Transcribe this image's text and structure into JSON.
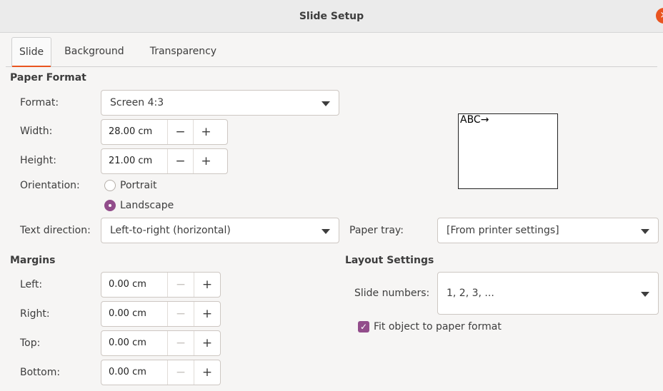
{
  "window": {
    "title": "Slide Setup",
    "close_glyph": "×"
  },
  "tabs": [
    {
      "label": "Slide",
      "active": true
    },
    {
      "label": "Background",
      "active": false
    },
    {
      "label": "Transparency",
      "active": false
    }
  ],
  "paper_format": {
    "heading": "Paper Format",
    "format_label": "Format:",
    "format_value": "Screen 4:3",
    "width_label": "Width:",
    "width_value": "28.00 cm",
    "height_label": "Height:",
    "height_value": "21.00 cm",
    "orientation_label": "Orientation:",
    "portrait_label": "Portrait",
    "landscape_label": "Landscape",
    "orientation_selected": "Landscape",
    "text_direction_label": "Text direction:",
    "text_direction_value": "Left-to-right (horizontal)",
    "paper_tray_label": "Paper tray:",
    "paper_tray_value": "[From printer settings]",
    "preview_text": "ABC→"
  },
  "margins": {
    "heading": "Margins",
    "left_label": "Left:",
    "left_value": "0.00 cm",
    "right_label": "Right:",
    "right_value": "0.00 cm",
    "top_label": "Top:",
    "top_value": "0.00 cm",
    "bottom_label": "Bottom:",
    "bottom_value": "0.00 cm"
  },
  "layout_settings": {
    "heading": "Layout Settings",
    "slide_numbers_label": "Slide numbers:",
    "slide_numbers_value": "1, 2, 3, ...",
    "fit_object_label": "Fit object to paper format",
    "fit_object_checked": true
  },
  "spin": {
    "minus": "−",
    "plus": "+"
  },
  "colors": {
    "accent": "#e95420",
    "check": "#924d8b"
  }
}
